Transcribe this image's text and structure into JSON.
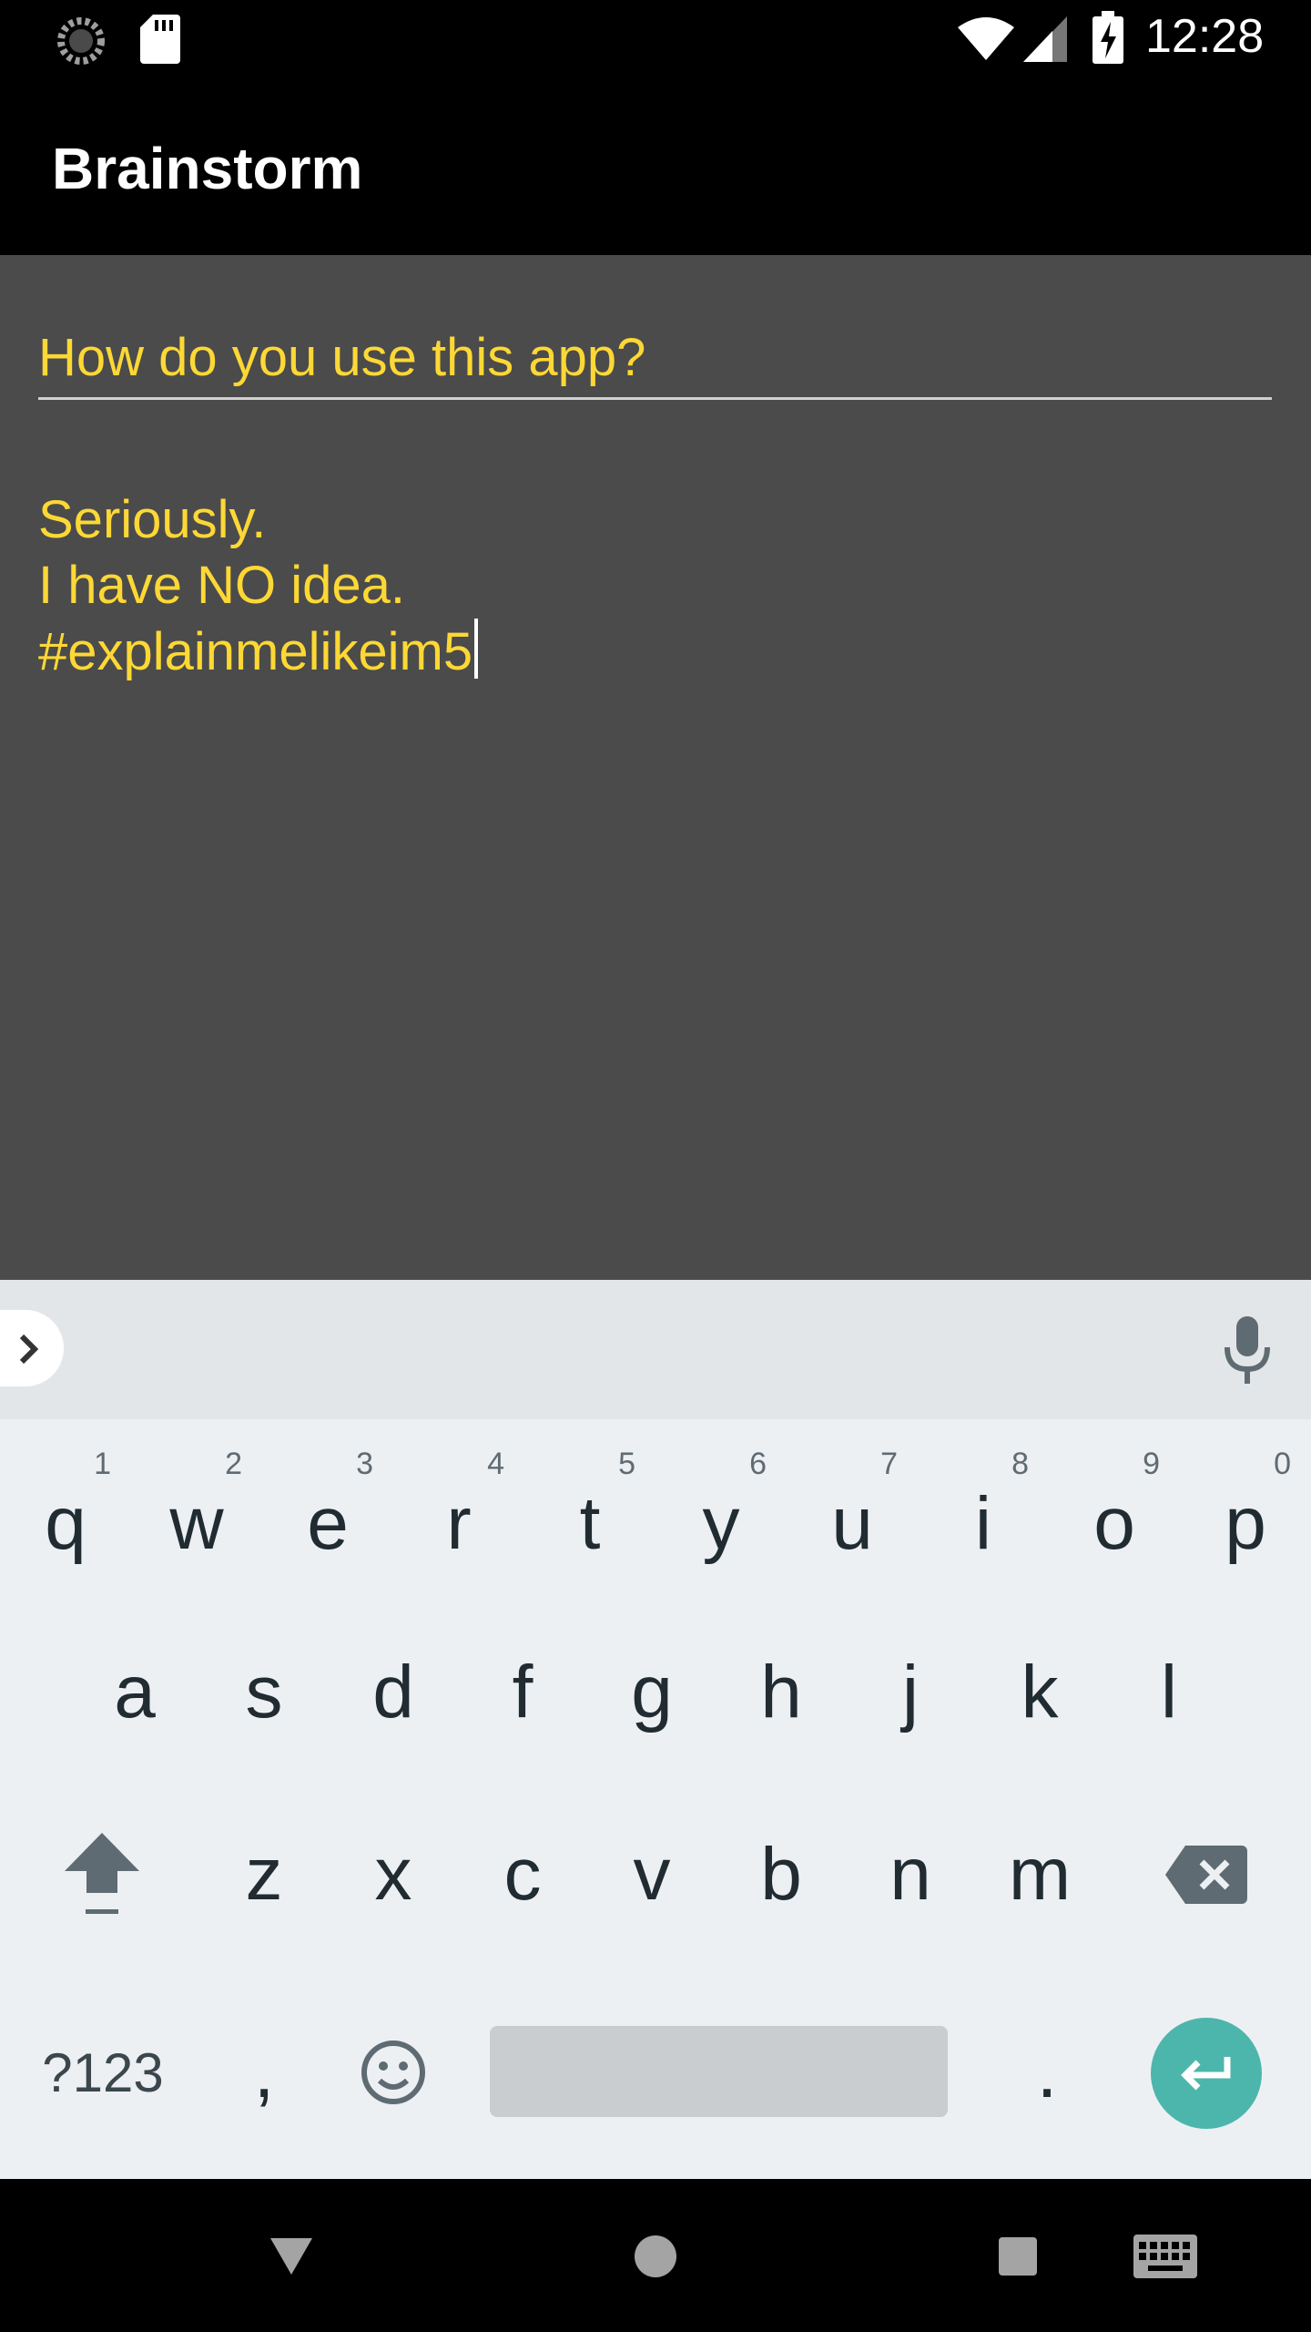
{
  "status_bar": {
    "time": "12:28",
    "icons": [
      "sync-icon",
      "sd-card-icon",
      "wifi-icon",
      "signal-icon",
      "battery-charging-icon"
    ]
  },
  "app_bar": {
    "title": "Brainstorm"
  },
  "editor": {
    "title_value": "How do you use this app?",
    "body_lines": [
      "Seriously.",
      "I have NO idea.",
      "#explainmelikeim5"
    ]
  },
  "colors": {
    "text_accent": "#fdd835",
    "editor_background": "#4b4b4b",
    "enter_key": "#4db6ac"
  },
  "keyboard": {
    "row1": [
      {
        "key": "q",
        "hint": "1"
      },
      {
        "key": "w",
        "hint": "2"
      },
      {
        "key": "e",
        "hint": "3"
      },
      {
        "key": "r",
        "hint": "4"
      },
      {
        "key": "t",
        "hint": "5"
      },
      {
        "key": "y",
        "hint": "6"
      },
      {
        "key": "u",
        "hint": "7"
      },
      {
        "key": "i",
        "hint": "8"
      },
      {
        "key": "o",
        "hint": "9"
      },
      {
        "key": "p",
        "hint": "0"
      }
    ],
    "row2": [
      "a",
      "s",
      "d",
      "f",
      "g",
      "h",
      "j",
      "k",
      "l"
    ],
    "row3": [
      "z",
      "x",
      "c",
      "v",
      "b",
      "n",
      "m"
    ],
    "symbols_label": "?123",
    "comma": ",",
    "period": "."
  },
  "nav_bar": {
    "icons": [
      "back-icon",
      "home-icon",
      "recents-icon",
      "keyboard-switch-icon"
    ]
  }
}
